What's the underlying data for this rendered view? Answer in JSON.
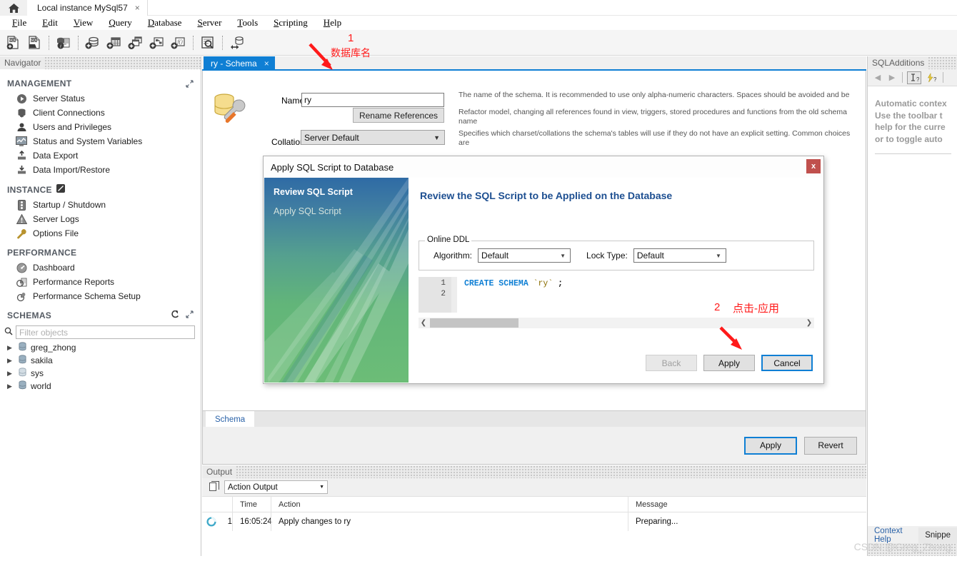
{
  "titlebar": {
    "home_icon": "home-icon",
    "connection_tab": "Local instance MySql57",
    "close_glyph": "×"
  },
  "menubar": {
    "items": [
      "File",
      "Edit",
      "View",
      "Query",
      "Database",
      "Server",
      "Tools",
      "Scripting",
      "Help"
    ]
  },
  "toolbar": {
    "icons": [
      "new-sql-tab-icon",
      "open-sql-script-icon",
      "connect-server-info-icon",
      "create-schema-icon",
      "create-table-icon",
      "create-view-icon",
      "create-stored-procedure-icon",
      "create-function-icon",
      "search-data-icon",
      "reconnect-server-icon"
    ]
  },
  "navigator": {
    "title": "Navigator",
    "groups": [
      {
        "label": "MANAGEMENT",
        "expand_icon": "expand-icon",
        "items": [
          {
            "label": "Server Status",
            "icon": "server-status-icon"
          },
          {
            "label": "Client Connections",
            "icon": "client-connections-icon"
          },
          {
            "label": "Users and Privileges",
            "icon": "users-privileges-icon"
          },
          {
            "label": "Status and System Variables",
            "icon": "status-variables-icon"
          },
          {
            "label": "Data Export",
            "icon": "data-export-icon"
          },
          {
            "label": "Data Import/Restore",
            "icon": "data-import-icon"
          }
        ]
      },
      {
        "label": "INSTANCE",
        "expand_icon": "instance-badge-icon",
        "items": [
          {
            "label": "Startup / Shutdown",
            "icon": "startup-shutdown-icon"
          },
          {
            "label": "Server Logs",
            "icon": "server-logs-icon"
          },
          {
            "label": "Options File",
            "icon": "options-file-icon"
          }
        ]
      },
      {
        "label": "PERFORMANCE",
        "expand_icon": "",
        "items": [
          {
            "label": "Dashboard",
            "icon": "dashboard-icon"
          },
          {
            "label": "Performance Reports",
            "icon": "performance-reports-icon"
          },
          {
            "label": "Performance Schema Setup",
            "icon": "performance-schema-setup-icon"
          }
        ]
      }
    ],
    "schemas": {
      "label": "SCHEMAS",
      "icons": [
        "refresh-icon",
        "expand-icon"
      ],
      "filter_placeholder": "Filter objects",
      "filter_value": "",
      "search_icon": "search-icon",
      "items": [
        "greg_zhong",
        "sakila",
        "sys",
        "world"
      ]
    }
  },
  "editor": {
    "tab_label": "ry - Schema",
    "tab_close": "×",
    "schema_icon": "schema-wrench-icon",
    "name_label": "Name:",
    "name_value": "ry",
    "rename_button": "Rename References",
    "collation_label": "Collation:",
    "collation_value": "Server Default",
    "hints": [
      "The name of the schema. It is recommended to use only alpha-numeric characters. Spaces should be avoided and be",
      "Refactor model, changing all references found in view, triggers, stored procedures and functions from the old schema name",
      "Specifies which charset/collations the schema's tables will use if they do not have an explicit setting. Common choices are"
    ],
    "bottom_tab": "Schema",
    "apply_button": "Apply",
    "revert_button": "Revert"
  },
  "output": {
    "title": "Output",
    "panel_icon": "output-panel-icon",
    "selector_value": "Action Output",
    "columns": [
      "",
      "",
      "Time",
      "Action",
      "Message"
    ],
    "rows": [
      {
        "status_icon": "progress-spinner-icon",
        "num": "1",
        "time": "16:05:24",
        "action": "Apply changes to ry",
        "message": "Preparing..."
      }
    ]
  },
  "right_panel": {
    "title": "SQLAdditions",
    "toolbar_icons": [
      "back-arrow-icon",
      "forward-arrow-icon",
      "context-help-icon",
      "auto-context-help-icon"
    ],
    "help_text_lines": [
      "Automatic contex",
      "Use the toolbar t",
      "help for the curre",
      "or to toggle auto"
    ],
    "tabs": [
      "Context Help",
      "Snippe"
    ]
  },
  "dialog": {
    "title": "Apply SQL Script to Database",
    "close_glyph": "x",
    "steps": [
      {
        "label": "Review SQL Script",
        "active": true
      },
      {
        "label": "Apply SQL Script",
        "active": false
      }
    ],
    "heading": "Review the SQL Script to be Applied on the Database",
    "fieldset_legend": "Online DDL",
    "algorithm_label": "Algorithm:",
    "algorithm_value": "Default",
    "lock_type_label": "Lock Type:",
    "lock_type_value": "Default",
    "sql_lines": [
      "1",
      "2"
    ],
    "sql_keyword": "CREATE SCHEMA",
    "sql_identifier": "`ry`",
    "sql_terminator": ";",
    "buttons": {
      "back": "Back",
      "apply": "Apply",
      "cancel": "Cancel"
    }
  },
  "annotations": [
    {
      "num": "1",
      "text": "数据库名"
    },
    {
      "num": "2",
      "text": "点击-应用"
    }
  ],
  "watermark": "CSDN @Greg_Zhong",
  "colors": {
    "accent_blue": "#0f7fd4",
    "dialog_heading": "#1d4f91",
    "annotation_red": "#ff1a1a",
    "close_red": "#c0504d"
  }
}
